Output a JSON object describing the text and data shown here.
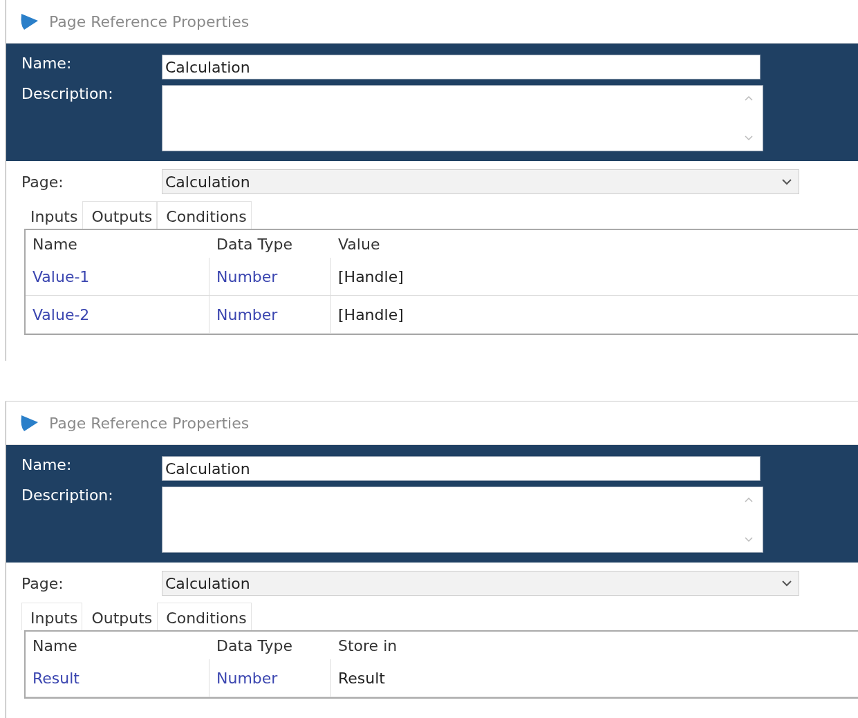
{
  "panels": [
    {
      "title": "Page Reference Properties",
      "name_label": "Name:",
      "name_value": "Calculation",
      "description_label": "Description:",
      "page_label": "Page:",
      "page_value": "Calculation",
      "tabs": [
        {
          "label": "Inputs",
          "selected": true
        },
        {
          "label": "Outputs",
          "selected": false
        },
        {
          "label": "Conditions",
          "selected": false
        }
      ],
      "columns": [
        "Name",
        "Data Type",
        "Value"
      ],
      "rows": [
        [
          "Value-1",
          "Number",
          "[Handle]"
        ],
        [
          "Value-2",
          "Number",
          "[Handle]"
        ]
      ]
    },
    {
      "title": "Page Reference Properties",
      "name_label": "Name:",
      "name_value": "Calculation",
      "description_label": "Description:",
      "page_label": "Page:",
      "page_value": "Calculation",
      "tabs": [
        {
          "label": "Inputs",
          "selected": false
        },
        {
          "label": "Outputs",
          "selected": true
        },
        {
          "label": "Conditions",
          "selected": false
        }
      ],
      "columns": [
        "Name",
        "Data Type",
        "Store in"
      ],
      "rows": [
        [
          "Result",
          "Number",
          "Result"
        ]
      ]
    }
  ]
}
